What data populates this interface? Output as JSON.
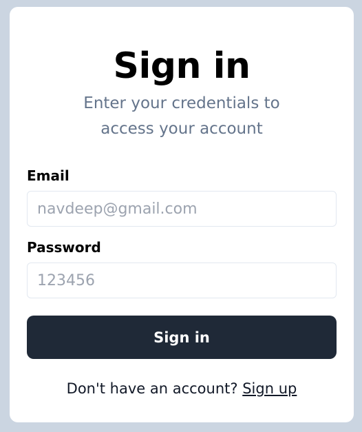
{
  "signin": {
    "title": "Sign in",
    "subtitle": "Enter your credentials to access your account",
    "email_label": "Email",
    "email_placeholder": "navdeep@gmail.com",
    "email_value": "",
    "password_label": "Password",
    "password_placeholder": "123456",
    "password_value": "",
    "button_label": "Sign in",
    "footer_text": "Don't have an account?",
    "footer_link": "Sign up"
  },
  "colors": {
    "background": "#cbd5e1",
    "card": "#ffffff",
    "button": "#1f2937",
    "subtitle": "#64748b",
    "placeholder": "#9ca3af"
  }
}
